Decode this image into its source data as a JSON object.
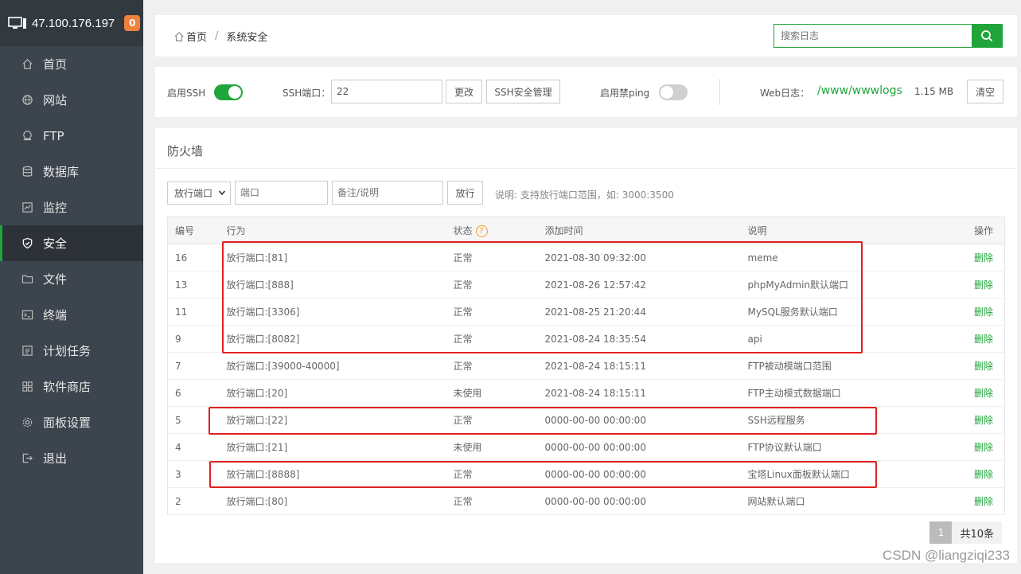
{
  "sidebar": {
    "server_ip": "47.100.176.197",
    "notice_count": "0",
    "items": [
      {
        "label": "首页",
        "icon": "home-icon"
      },
      {
        "label": "网站",
        "icon": "globe-icon"
      },
      {
        "label": "FTP",
        "icon": "ftp-icon"
      },
      {
        "label": "数据库",
        "icon": "database-icon"
      },
      {
        "label": "监控",
        "icon": "monitor-icon"
      },
      {
        "label": "安全",
        "icon": "shield-icon",
        "active": true
      },
      {
        "label": "文件",
        "icon": "folder-icon"
      },
      {
        "label": "终端",
        "icon": "terminal-icon"
      },
      {
        "label": "计划任务",
        "icon": "clock-icon"
      },
      {
        "label": "软件商店",
        "icon": "grid-icon"
      },
      {
        "label": "面板设置",
        "icon": "gear-icon"
      },
      {
        "label": "退出",
        "icon": "logout-icon"
      }
    ]
  },
  "breadcrumb": {
    "home": "首页",
    "separator": "/",
    "current": "系统安全"
  },
  "search": {
    "placeholder": "搜索日志"
  },
  "ssh": {
    "enable_label": "启用SSH",
    "ssh_enabled": true,
    "port_label": "SSH端口：",
    "port_value": "22",
    "change_button": "更改",
    "manage_button": "SSH安全管理",
    "ping_label": "启用禁ping",
    "ping_enabled": false,
    "weblog_label": "Web日志：",
    "weblog_path": "/www/wwwlogs",
    "weblog_size": "1.15 MB",
    "clear_button": "清空"
  },
  "firewall": {
    "title": "防火墙",
    "select_value": "放行端口",
    "port_placeholder": "端口",
    "remark_placeholder": "备注/说明",
    "allow_button": "放行",
    "hint": "说明: 支持放行端口范围，如: 3000:3500",
    "columns": [
      "编号",
      "行为",
      "状态",
      "添加时间",
      "说明",
      "操作"
    ],
    "rows": [
      {
        "id": "16",
        "action": "放行端口:[81]",
        "status": "正常",
        "time": "2021-08-30 09:32:00",
        "note": "meme",
        "op": "删除"
      },
      {
        "id": "13",
        "action": "放行端口:[888]",
        "status": "正常",
        "time": "2021-08-26 12:57:42",
        "note": "phpMyAdmin默认端口",
        "op": "删除"
      },
      {
        "id": "11",
        "action": "放行端口:[3306]",
        "status": "正常",
        "time": "2021-08-25 21:20:44",
        "note": "MySQL服务默认端口",
        "op": "删除"
      },
      {
        "id": "9",
        "action": "放行端口:[8082]",
        "status": "正常",
        "time": "2021-08-24 18:35:54",
        "note": "api",
        "op": "删除"
      },
      {
        "id": "7",
        "action": "放行端口:[39000-40000]",
        "status": "正常",
        "time": "2021-08-24 18:15:11",
        "note": "FTP被动模端口范围",
        "op": "删除"
      },
      {
        "id": "6",
        "action": "放行端口:[20]",
        "status": "未使用",
        "time": "2021-08-24 18:15:11",
        "note": "FTP主动模式数据端口",
        "op": "删除"
      },
      {
        "id": "5",
        "action": "放行端口:[22]",
        "status": "正常",
        "time": "0000-00-00 00:00:00",
        "note": "SSH远程服务",
        "op": "删除"
      },
      {
        "id": "4",
        "action": "放行端口:[21]",
        "status": "未使用",
        "time": "0000-00-00 00:00:00",
        "note": "FTP协议默认端口",
        "op": "删除"
      },
      {
        "id": "3",
        "action": "放行端口:[8888]",
        "status": "正常",
        "time": "0000-00-00 00:00:00",
        "note": "宝塔Linux面板默认端口",
        "op": "删除"
      },
      {
        "id": "2",
        "action": "放行端口:[80]",
        "status": "正常",
        "time": "0000-00-00 00:00:00",
        "note": "网站默认端口",
        "op": "删除"
      }
    ],
    "page": "1",
    "total": "共10条"
  },
  "watermark": "CSDN @liangziqi233",
  "colors": {
    "accent": "#20a53a",
    "sidebar": "#3c444d",
    "highlight": "#e02020",
    "badge": "#f0803c"
  }
}
